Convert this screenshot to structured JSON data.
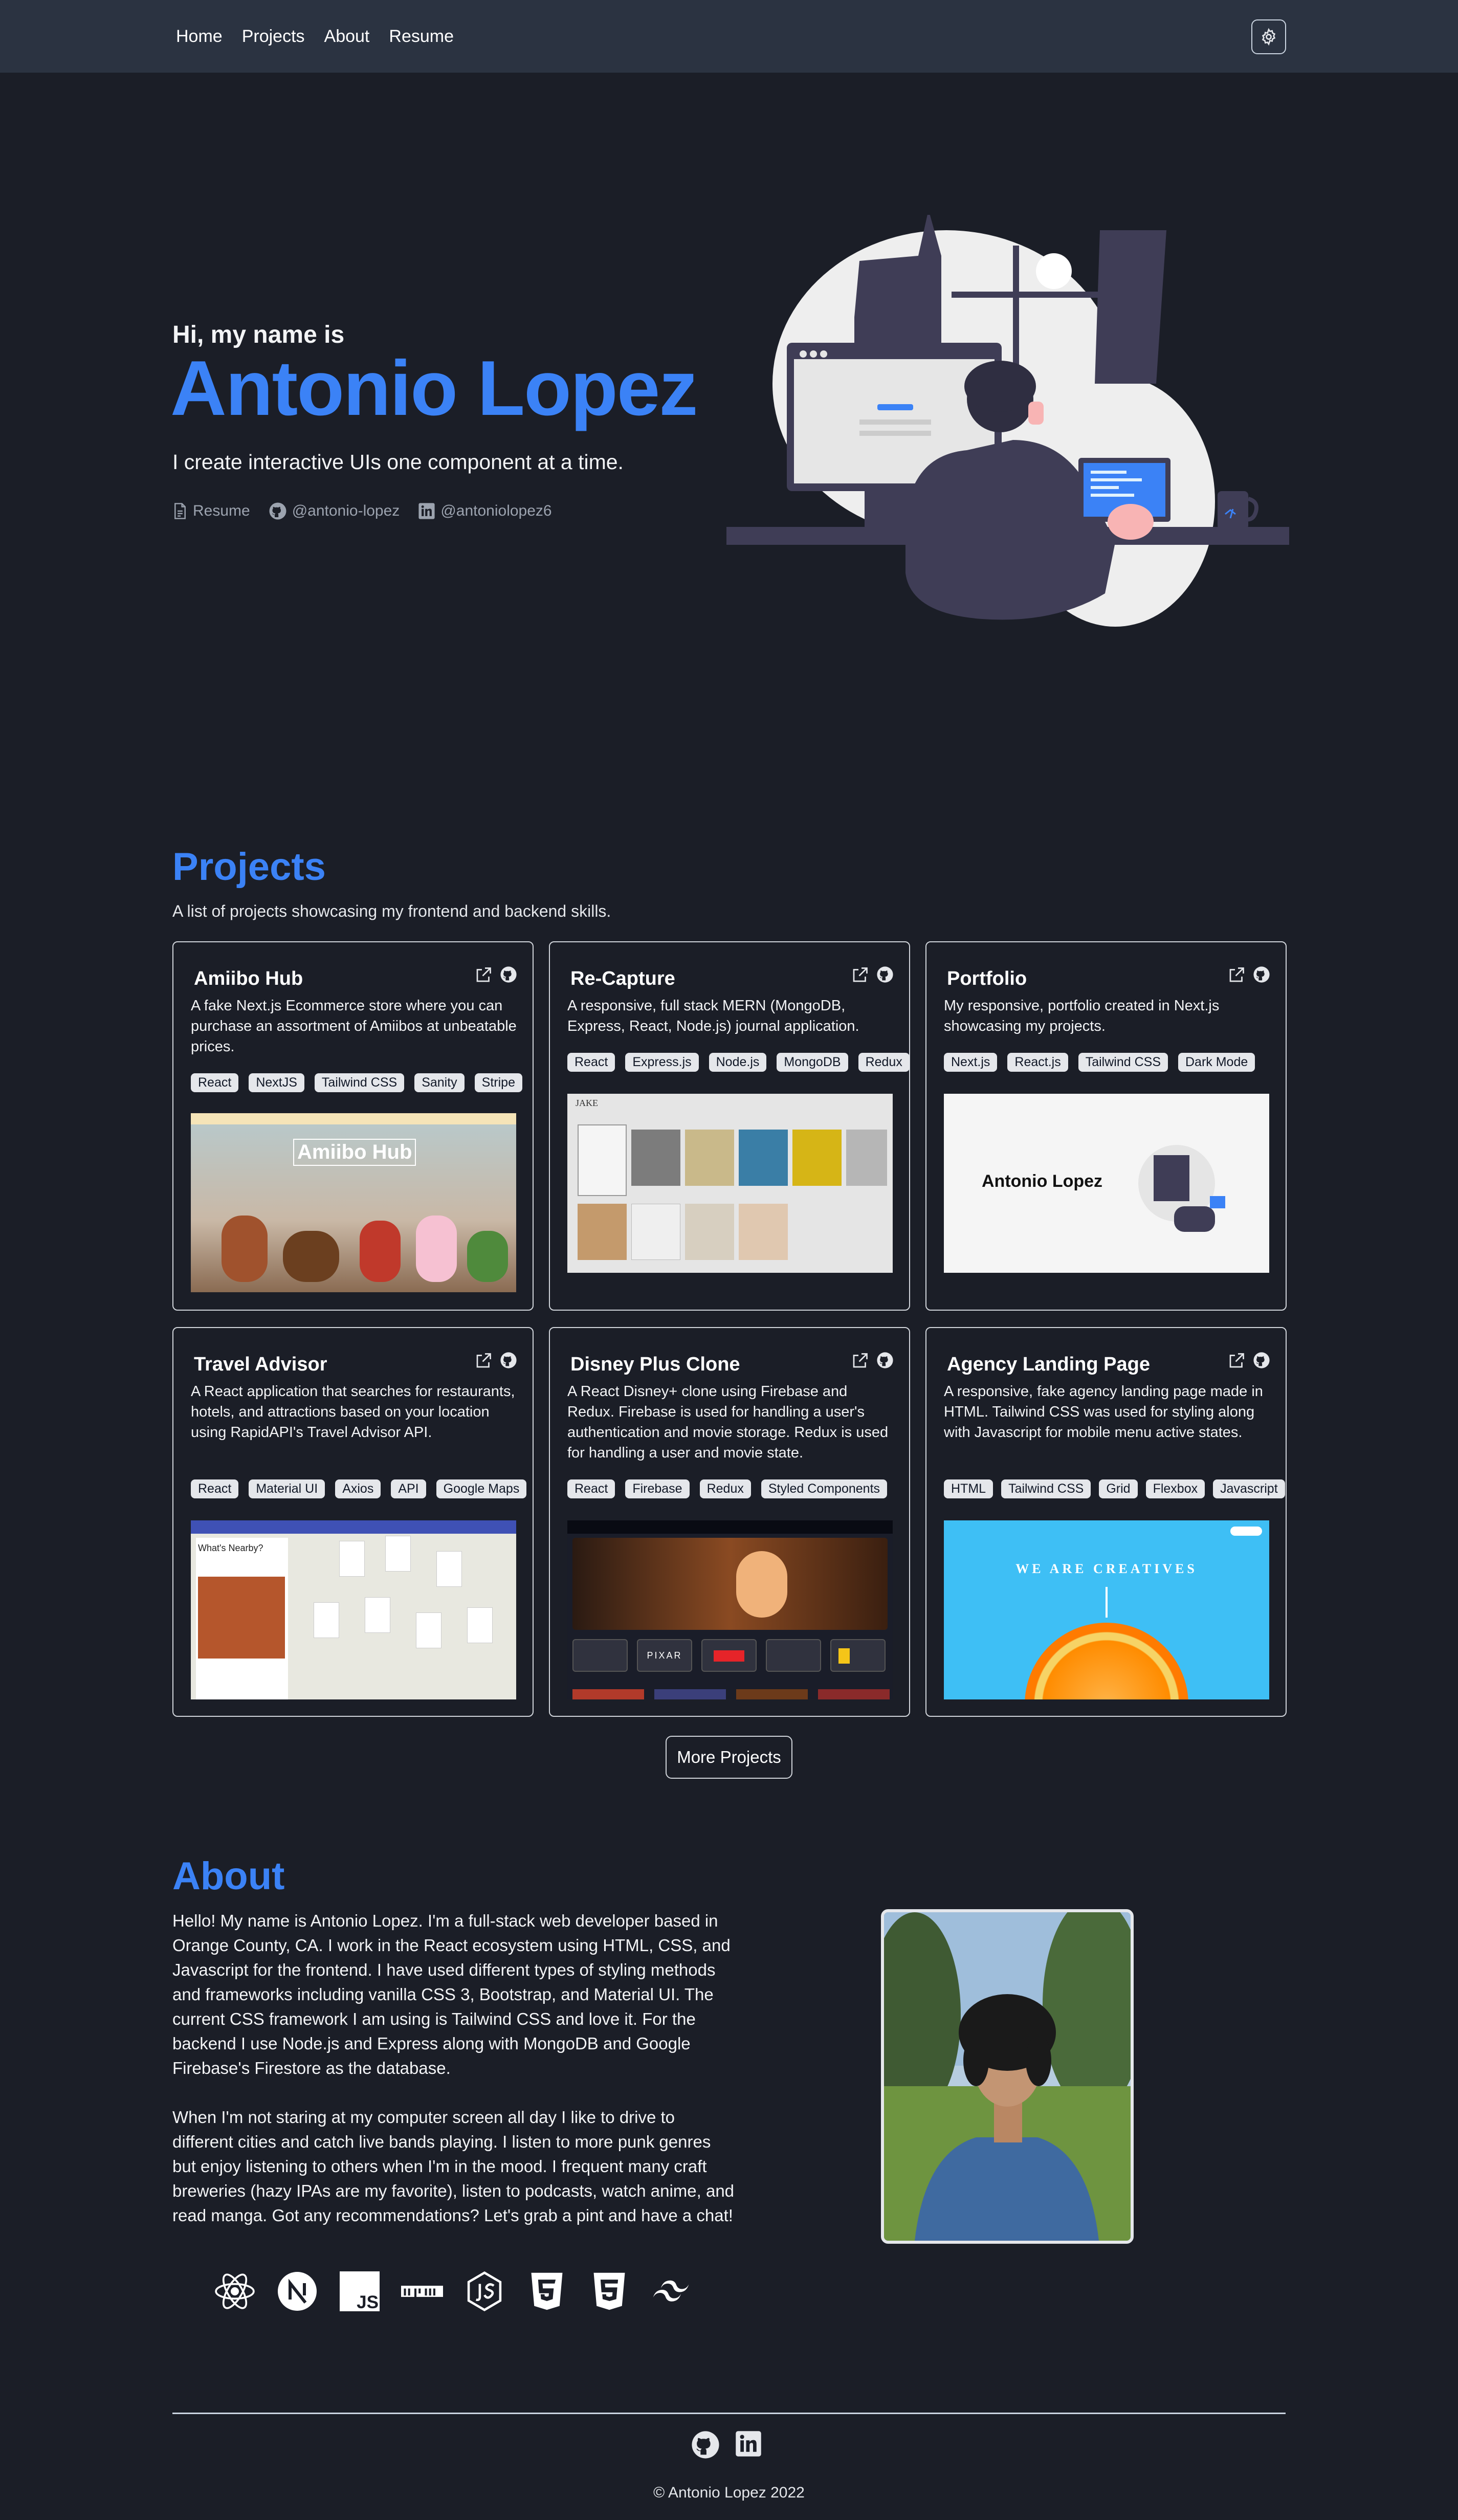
{
  "nav": {
    "links": [
      "Home",
      "Projects",
      "About",
      "Resume"
    ],
    "settings_icon": "gear-icon"
  },
  "hero": {
    "greeting": "Hi, my name is",
    "name": "Antonio Lopez",
    "tagline": "I create interactive UIs one component at a time.",
    "links": [
      {
        "label": "Resume",
        "icon": "document-icon"
      },
      {
        "label": "@antonio-lopez",
        "icon": "github-icon"
      },
      {
        "label": "@antoniolopez6",
        "icon": "linkedin-icon"
      }
    ]
  },
  "projects": {
    "title": "Projects",
    "subtitle": "A list of projects showcasing my frontend and backend skills.",
    "cards": [
      {
        "title": "Amiibo Hub",
        "description": "A fake Next.js Ecommerce store where you can purchase an assortment of Amiibos at unbeatable prices.",
        "tags": [
          "React",
          "NextJS",
          "Tailwind CSS",
          "Sanity",
          "Stripe"
        ],
        "screenshot_caption": "Amiibo Hub"
      },
      {
        "title": "Re-Capture",
        "description": "A responsive, full stack MERN (MongoDB, Express, React, Node.js) journal application.",
        "tags": [
          "React",
          "Express.js",
          "Node.js",
          "MongoDB",
          "Redux"
        ],
        "screenshot_caption": "JAKE"
      },
      {
        "title": "Portfolio",
        "description": "My responsive, portfolio created in Next.js showcasing my projects.",
        "tags": [
          "Next.js",
          "React.js",
          "Tailwind CSS",
          "Dark Mode"
        ],
        "screenshot_caption": "Antonio Lopez"
      },
      {
        "title": "Travel Advisor",
        "description": "A React application that searches for restaurants, hotels, and attractions based on your location using RapidAPI's Travel Advisor API.",
        "tags": [
          "React",
          "Material UI",
          "Axios",
          "API",
          "Google Maps"
        ],
        "screenshot_caption": "What's Nearby?"
      },
      {
        "title": "Disney Plus Clone",
        "description": "A React Disney+ clone using Firebase and Redux. Firebase is used for handling a user's authentication and movie storage. Redux is used for handling a user and movie state.",
        "tags": [
          "React",
          "Firebase",
          "Redux",
          "Styled Components"
        ],
        "screenshot_caption": "PIXAR"
      },
      {
        "title": "Agency Landing Page",
        "description": "A responsive, fake agency landing page made in HTML. Tailwind CSS was used for styling along with Javascript for mobile menu active states.",
        "tags": [
          "HTML",
          "Tailwind CSS",
          "Grid",
          "Flexbox",
          "Javascript"
        ],
        "screenshot_caption": "WE ARE CREATIVES"
      }
    ],
    "more_label": "More Projects"
  },
  "about": {
    "title": "About",
    "paragraph1": "Hello! My name is Antonio Lopez. I'm a full-stack web developer based in Orange County, CA. I work in the React ecosystem using HTML, CSS, and Javascript for the frontend. I have used different types of styling methods and frameworks including vanilla CSS 3, Bootstrap, and Material UI. The current CSS framework I am using is Tailwind CSS and love it. For the backend I use Node.js and Express along with MongoDB and Google Firebase's Firestore as the database.",
    "paragraph2": "When I'm not staring at my computer screen all day I like to drive to different cities and catch live bands playing. I listen to more punk genres but enjoy listening to others when I'm in the mood. I frequent many craft breweries (hazy IPAs are my favorite), listen to podcasts, watch anime, and read manga. Got any recommendations? Let's grab a pint and have a chat!",
    "tech_icons": [
      "react-icon",
      "nextjs-icon",
      "javascript-icon",
      "npm-icon",
      "nodejs-icon",
      "html5-icon",
      "css3-icon",
      "tailwind-icon"
    ]
  },
  "footer": {
    "icons": [
      "github-icon",
      "linkedin-icon"
    ],
    "copyright": "© Antonio Lopez 2022"
  }
}
